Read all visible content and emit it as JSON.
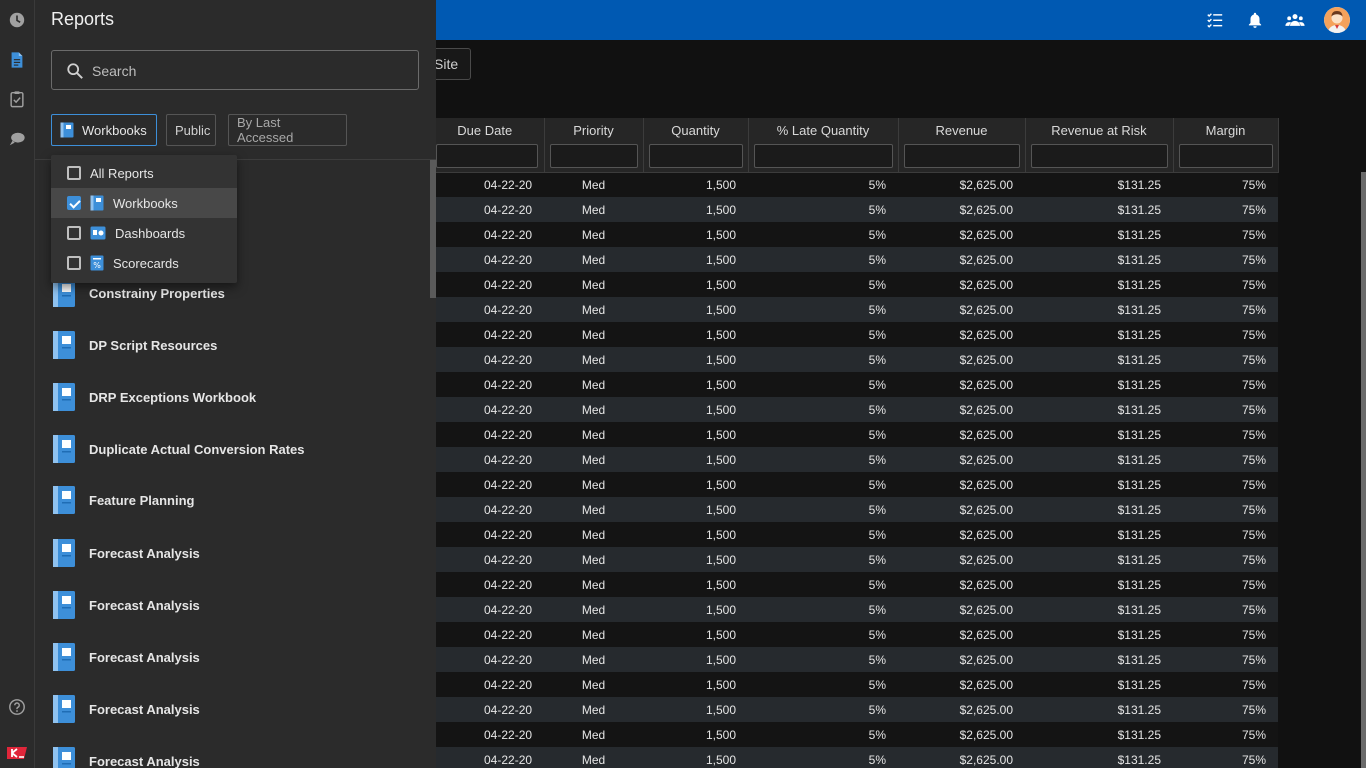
{
  "colors": {
    "brand_blue": "#0059b2",
    "accent": "#3d8fd9",
    "logo_red": "#e0263a"
  },
  "rail": {
    "icons": [
      "clock-icon",
      "document-icon",
      "clipboard-icon",
      "comment-icon",
      "help-icon",
      "brand-logo"
    ]
  },
  "topbar": {
    "icons": [
      "checklist-icon",
      "bell-icon",
      "people-icon",
      "user-avatar"
    ]
  },
  "toolbar": {
    "site_label": "Site"
  },
  "table": {
    "columns": [
      "Due Date",
      "Priority",
      "Quantity",
      "% Late Quantity",
      "Revenue",
      "Revenue at Risk",
      "Margin"
    ],
    "rows": [
      [
        "04-22-20",
        "Med",
        "1,500",
        "5%",
        "$2,625.00",
        "$131.25",
        "75%"
      ],
      [
        "04-22-20",
        "Med",
        "1,500",
        "5%",
        "$2,625.00",
        "$131.25",
        "75%"
      ],
      [
        "04-22-20",
        "Med",
        "1,500",
        "5%",
        "$2,625.00",
        "$131.25",
        "75%"
      ],
      [
        "04-22-20",
        "Med",
        "1,500",
        "5%",
        "$2,625.00",
        "$131.25",
        "75%"
      ],
      [
        "04-22-20",
        "Med",
        "1,500",
        "5%",
        "$2,625.00",
        "$131.25",
        "75%"
      ],
      [
        "04-22-20",
        "Med",
        "1,500",
        "5%",
        "$2,625.00",
        "$131.25",
        "75%"
      ],
      [
        "04-22-20",
        "Med",
        "1,500",
        "5%",
        "$2,625.00",
        "$131.25",
        "75%"
      ],
      [
        "04-22-20",
        "Med",
        "1,500",
        "5%",
        "$2,625.00",
        "$131.25",
        "75%"
      ],
      [
        "04-22-20",
        "Med",
        "1,500",
        "5%",
        "$2,625.00",
        "$131.25",
        "75%"
      ],
      [
        "04-22-20",
        "Med",
        "1,500",
        "5%",
        "$2,625.00",
        "$131.25",
        "75%"
      ],
      [
        "04-22-20",
        "Med",
        "1,500",
        "5%",
        "$2,625.00",
        "$131.25",
        "75%"
      ],
      [
        "04-22-20",
        "Med",
        "1,500",
        "5%",
        "$2,625.00",
        "$131.25",
        "75%"
      ],
      [
        "04-22-20",
        "Med",
        "1,500",
        "5%",
        "$2,625.00",
        "$131.25",
        "75%"
      ],
      [
        "04-22-20",
        "Med",
        "1,500",
        "5%",
        "$2,625.00",
        "$131.25",
        "75%"
      ],
      [
        "04-22-20",
        "Med",
        "1,500",
        "5%",
        "$2,625.00",
        "$131.25",
        "75%"
      ],
      [
        "04-22-20",
        "Med",
        "1,500",
        "5%",
        "$2,625.00",
        "$131.25",
        "75%"
      ],
      [
        "04-22-20",
        "Med",
        "1,500",
        "5%",
        "$2,625.00",
        "$131.25",
        "75%"
      ],
      [
        "04-22-20",
        "Med",
        "1,500",
        "5%",
        "$2,625.00",
        "$131.25",
        "75%"
      ],
      [
        "04-22-20",
        "Med",
        "1,500",
        "5%",
        "$2,625.00",
        "$131.25",
        "75%"
      ],
      [
        "04-22-20",
        "Med",
        "1,500",
        "5%",
        "$2,625.00",
        "$131.25",
        "75%"
      ],
      [
        "04-22-20",
        "Med",
        "1,500",
        "5%",
        "$2,625.00",
        "$131.25",
        "75%"
      ],
      [
        "04-22-20",
        "Med",
        "1,500",
        "5%",
        "$2,625.00",
        "$131.25",
        "75%"
      ],
      [
        "04-22-20",
        "Med",
        "1,500",
        "5%",
        "$2,625.00",
        "$131.25",
        "75%"
      ],
      [
        "04-22-20",
        "Med",
        "1,500",
        "5%",
        "$2,625.00",
        "$131.25",
        "75%"
      ]
    ]
  },
  "panel": {
    "title": "Reports",
    "search_placeholder": "Search",
    "chips": {
      "type": "Workbooks",
      "visibility": "Public",
      "sort": "By Last Accessed"
    },
    "dropdown": [
      {
        "label": "All Reports",
        "checked": false,
        "icon": "none"
      },
      {
        "label": "Workbooks",
        "checked": true,
        "icon": "workbook-icon"
      },
      {
        "label": "Dashboards",
        "checked": false,
        "icon": "dashboard-icon"
      },
      {
        "label": "Scorecards",
        "checked": false,
        "icon": "scorecard-icon"
      }
    ],
    "reports": [
      "Constrainy Properties",
      "DP Script Resources",
      "DRP Exceptions Workbook",
      "Duplicate Actual Conversion Rates",
      "Feature Planning",
      "Forecast Analysis",
      "Forecast Analysis",
      "Forecast Analysis",
      "Forecast Analysis",
      "Forecast Analysis"
    ]
  }
}
